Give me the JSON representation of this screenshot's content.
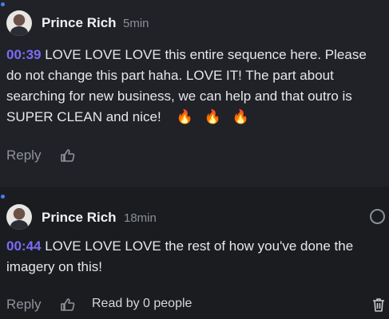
{
  "comments": [
    {
      "author": "Prince Rich",
      "time": "5min",
      "timestamp": "00:39",
      "text": "LOVE LOVE LOVE this entire sequence here. Please do not change this part haha. LOVE IT! The part about searching for new business, we can help and that outro is SUPER CLEAN and nice!",
      "emojis": [
        "🔥",
        "🔥",
        "🔥"
      ],
      "reply_label": "Reply"
    },
    {
      "author": "Prince Rich",
      "time": "18min",
      "timestamp": "00:44",
      "text": "LOVE LOVE LOVE the rest of how you've done the imagery on this!",
      "reply_label": "Reply",
      "read_by": "Read by 0 people"
    }
  ],
  "colors": {
    "background": "#1a1c20",
    "highlighted_comment": "#202227",
    "timestamp": "#7b6cf6",
    "unread_dot": "#4b7cf5"
  }
}
